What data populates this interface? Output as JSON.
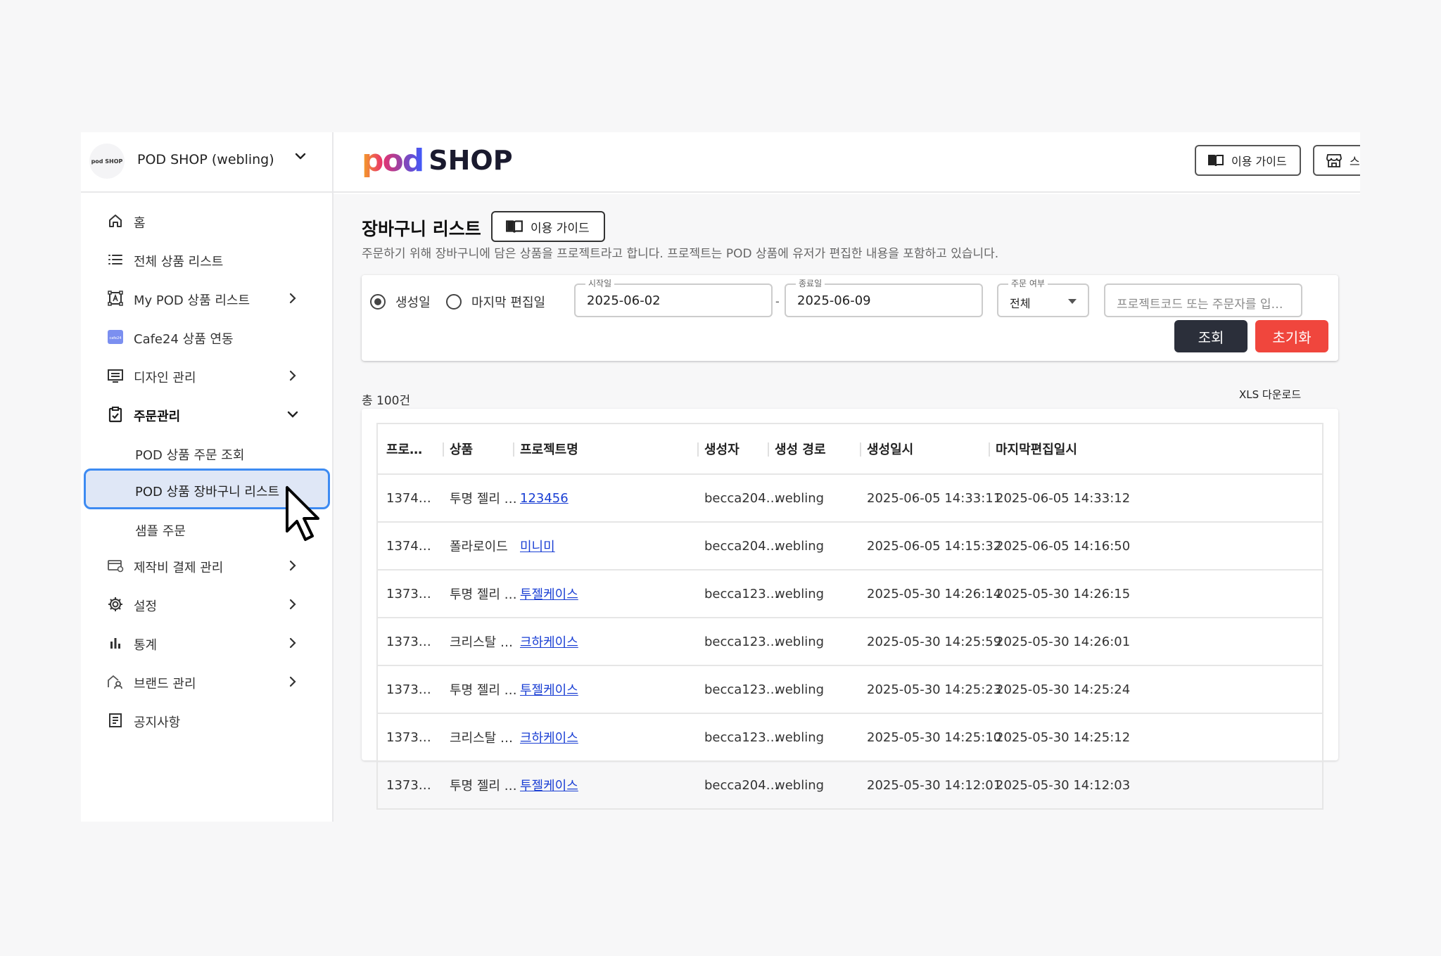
{
  "store": {
    "name": "POD SHOP (webling)",
    "logo_text": "pod SHOP"
  },
  "brand": {
    "pod": "pod",
    "shop": "SHOP"
  },
  "header": {
    "guide_label": "이용 가이드",
    "store_label": "스토어 관리"
  },
  "sidebar": {
    "items": [
      {
        "label": "홈",
        "icon": "home-icon"
      },
      {
        "label": "전체 상품 리스트",
        "icon": "list-icon"
      },
      {
        "label": "My POD 상품 리스트",
        "icon": "frame-a-icon"
      },
      {
        "label": "Cafe24 상품 연동",
        "icon": "cafe24-icon"
      },
      {
        "label": "디자인 관리",
        "icon": "monitor-icon"
      },
      {
        "label": "주문관리",
        "icon": "clipboard-icon"
      },
      {
        "label": "제작비 결제 관리",
        "icon": "card-icon"
      },
      {
        "label": "설정",
        "icon": "gear-icon"
      },
      {
        "label": "통계",
        "icon": "bar-chart-icon"
      },
      {
        "label": "브랜드 관리",
        "icon": "brand-icon"
      },
      {
        "label": "공지사항",
        "icon": "notice-icon"
      }
    ],
    "order_sub": [
      "POD 상품 주문 조회",
      "POD 상품 장바구니 리스트",
      "샘플 주문"
    ]
  },
  "page": {
    "title": "장바구니 리스트",
    "guide_label": "이용 가이드",
    "description": "주문하기 위해 장바구니에 담은 상품을 프로젝트라고 합니다. 프로젝트는 POD 상품에 유저가 편집한 내용을 포함하고 있습니다."
  },
  "filter": {
    "radio_created": "생성일",
    "radio_edited": "마지막 편집일",
    "selected_radio": "생성일",
    "start_label": "시작일",
    "start_value": "2025-06-02",
    "dash": "-",
    "end_label": "종료일",
    "end_value": "2025-06-09",
    "order_label": "주문 여부",
    "order_value": "전체",
    "search_placeholder": "프로젝트코드 또는 주문자를 입력하세요",
    "search_button": "조회",
    "reset_button": "초기화"
  },
  "total": "총 100건",
  "xls": "XLS 다운로드",
  "table": {
    "headers": [
      "프로…",
      "상품",
      "프로젝트명",
      "생성자",
      "생성 경로",
      "생성일시",
      "마지막편집일시"
    ],
    "rows": [
      [
        "1374…",
        "투명 젤리 …",
        "123456",
        "becca204…",
        "webling",
        "2025-06-05 14:33:11",
        "2025-06-05 14:33:12"
      ],
      [
        "1374…",
        "폴라로이드",
        "미니미",
        "becca204…",
        "webling",
        "2025-06-05 14:15:32",
        "2025-06-05 14:16:50"
      ],
      [
        "1373…",
        "투명 젤리 …",
        "투젤케이스",
        "becca123…",
        "webling",
        "2025-05-30 14:26:14",
        "2025-05-30 14:26:15"
      ],
      [
        "1373…",
        "크리스탈 …",
        "크하케이스",
        "becca123…",
        "webling",
        "2025-05-30 14:25:59",
        "2025-05-30 14:26:01"
      ],
      [
        "1373…",
        "투명 젤리 …",
        "투젤케이스",
        "becca123…",
        "webling",
        "2025-05-30 14:25:23",
        "2025-05-30 14:25:24"
      ],
      [
        "1373…",
        "크리스탈 …",
        "크하케이스",
        "becca123…",
        "webling",
        "2025-05-30 14:25:10",
        "2025-05-30 14:25:12"
      ],
      [
        "1373…",
        "투명 젤리 …",
        "투젤케이스",
        "becca204…",
        "webling",
        "2025-05-30 14:12:01",
        "2025-05-30 14:12:03"
      ]
    ]
  },
  "colors": {
    "accent_blue": "#3d8bf2",
    "search_btn": "#2b2f3a",
    "reset_btn": "#f0463d",
    "link": "#1a3fd4"
  }
}
